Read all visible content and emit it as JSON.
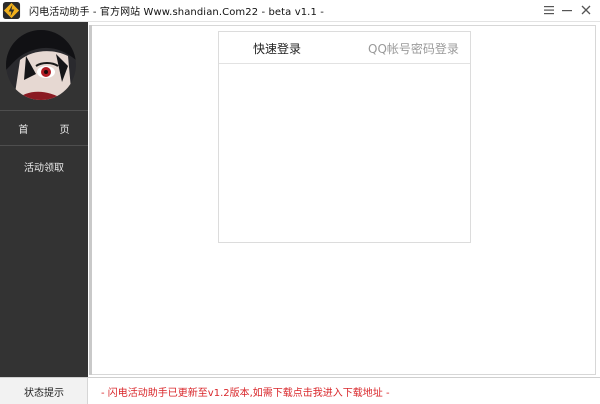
{
  "titlebar": {
    "title": "闪电活动助手 - 官方网站 Www.shandian.Com22 -  beta v1.1 -",
    "menu_icon": "hamburger-menu-icon",
    "minimize_icon": "minimize-icon",
    "close_icon": "close-icon",
    "logo_color": "#f0b01c"
  },
  "sidebar": {
    "background": "#333333",
    "items": [
      {
        "label": "首  页"
      },
      {
        "label": "活动领取"
      }
    ]
  },
  "login": {
    "tabs": [
      {
        "label": "快速登录",
        "active": true
      },
      {
        "label": "QQ帐号密码登录",
        "active": false
      }
    ]
  },
  "status": {
    "label": "状态提示",
    "message": "- 闪电活动助手已更新至v1.2版本,如需下载点击我进入下载地址 -",
    "message_color": "#d9262a"
  }
}
